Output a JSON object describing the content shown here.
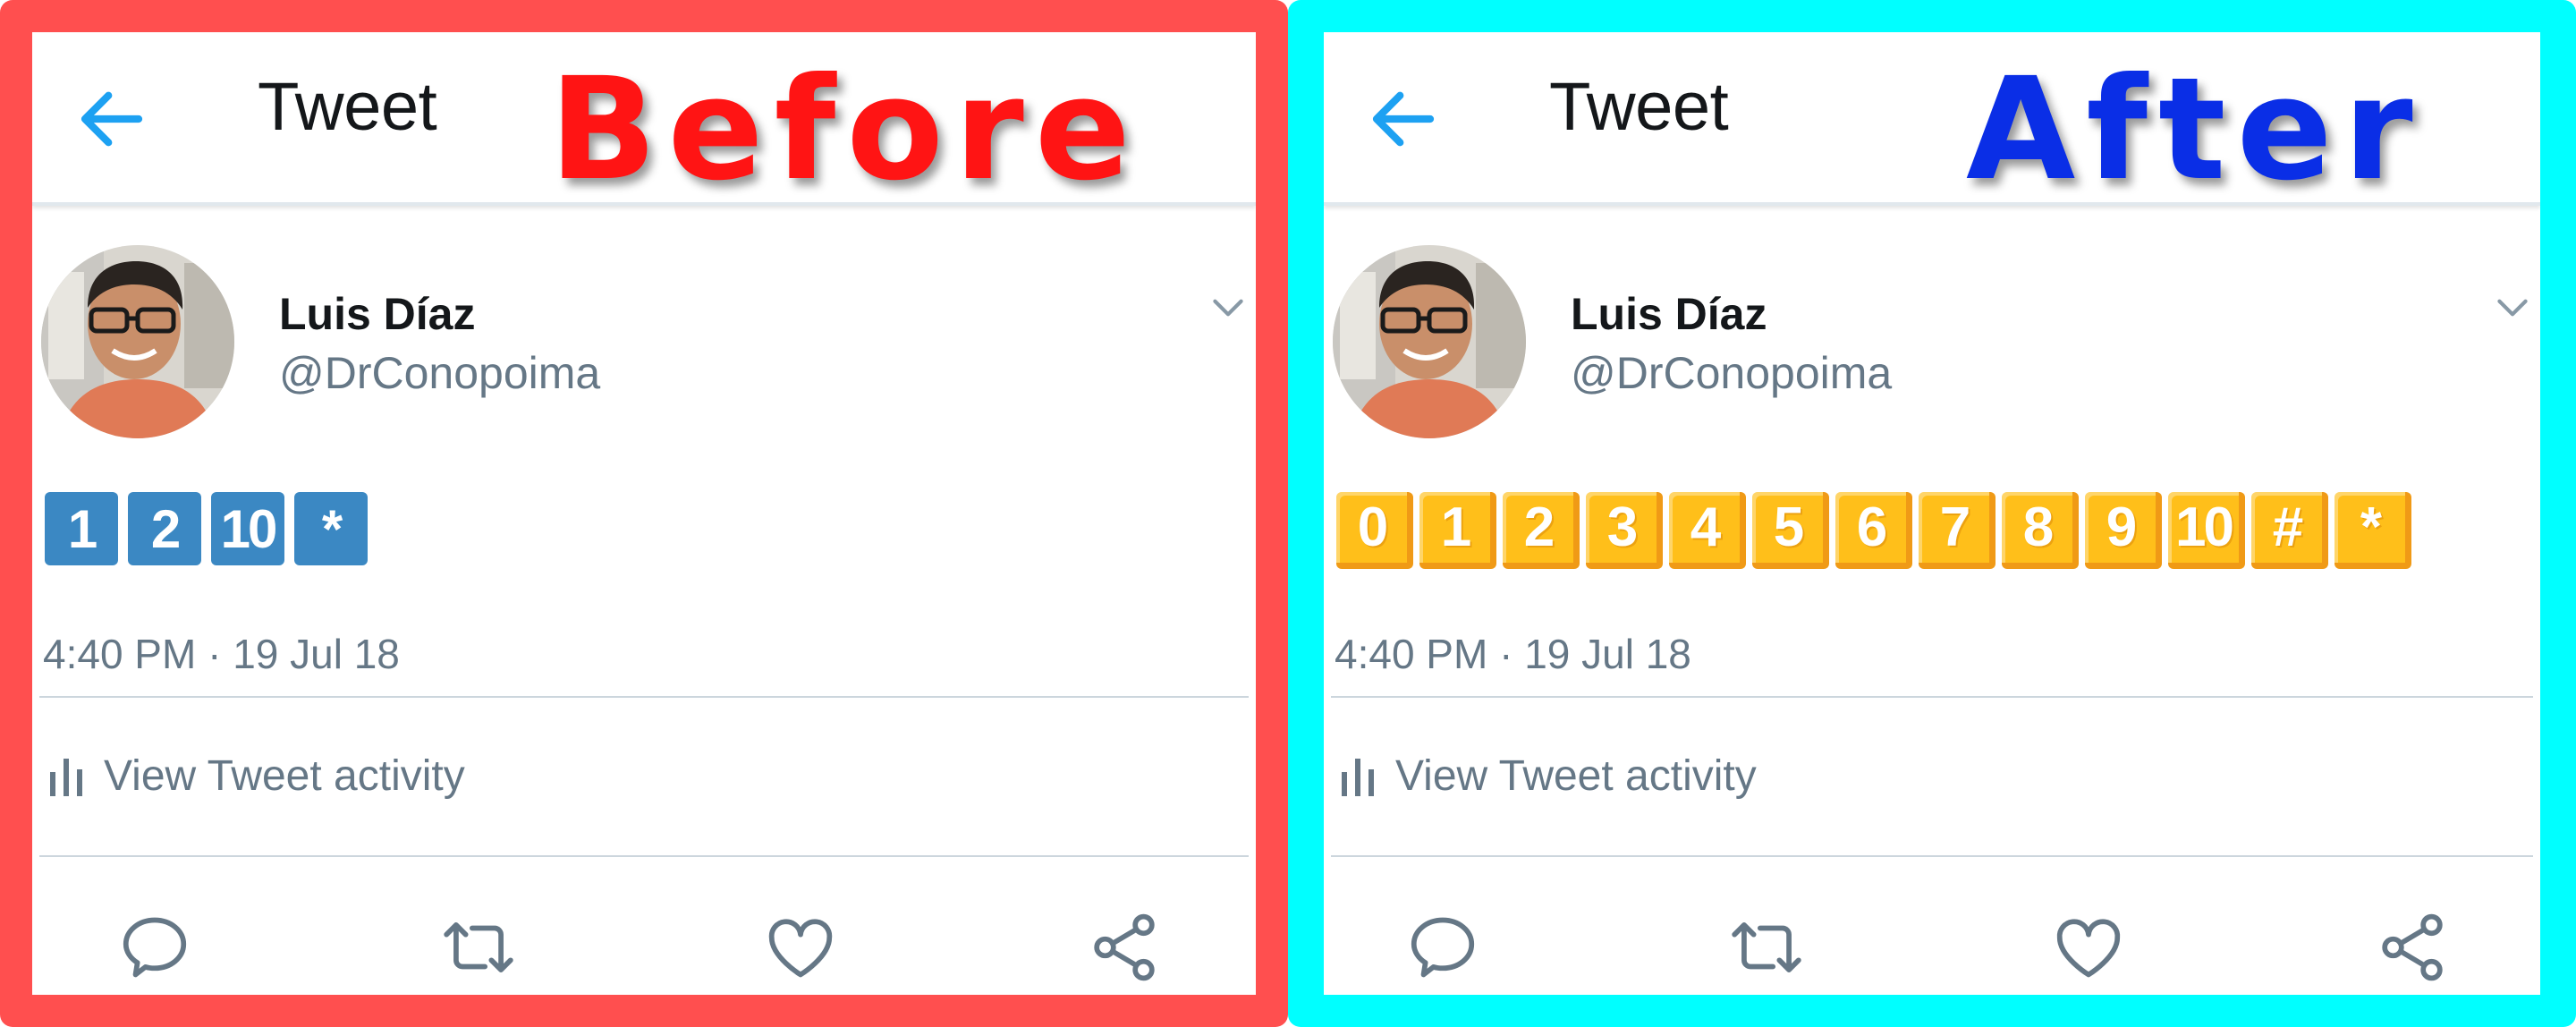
{
  "header": {
    "title": "Tweet"
  },
  "user": {
    "name": "Luis Díaz",
    "handle": "@DrConopoima"
  },
  "timestamp": "4:40 PM · 19 Jul 18",
  "activity_link": "View Tweet activity",
  "panels": {
    "before": {
      "label": "Before",
      "border_color": "#ff4f4f",
      "label_color": "#ff1414",
      "keycaps": [
        "1",
        "2",
        "10",
        "*"
      ],
      "keycap_style": "blue"
    },
    "after": {
      "label": "After",
      "border_color": "#00ffff",
      "label_color": "#0a2ee6",
      "keycaps": [
        "0",
        "1",
        "2",
        "3",
        "4",
        "5",
        "6",
        "7",
        "8",
        "9",
        "10",
        "#",
        "*"
      ],
      "keycap_style": "orange"
    }
  },
  "icons": {
    "back": "back-arrow-icon",
    "chevron": "chevron-down-icon",
    "activity": "bar-chart-icon",
    "actions": [
      "reply-icon",
      "retweet-icon",
      "like-icon",
      "share-icon"
    ]
  },
  "colors": {
    "twitter_blue": "#1da1f2",
    "text_primary": "#14171a",
    "text_secondary": "#657786",
    "keycap_blue": "#3b88c3",
    "keycap_orange": "#ffbf1a"
  }
}
